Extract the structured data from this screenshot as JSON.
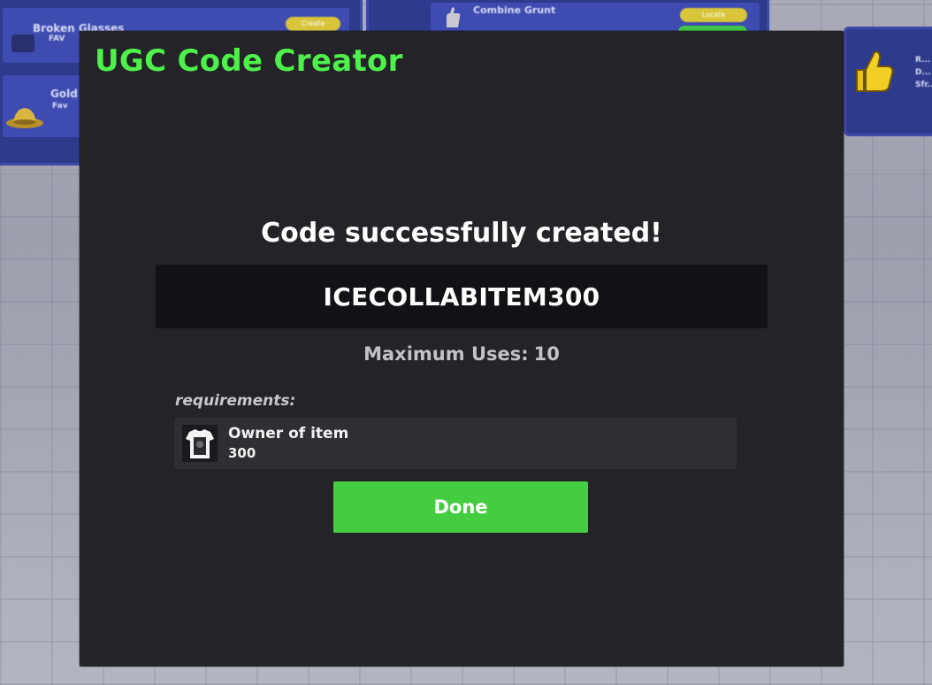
{
  "background": {
    "items": [
      {
        "name": "Broken Glasses",
        "sub": "FAV",
        "button": "Create"
      },
      {
        "name": "Gold",
        "sub": "Fav"
      },
      {
        "name": "Combine Grunt",
        "button": "Locate"
      }
    ],
    "right_note": "R... D... Sfr..."
  },
  "modal": {
    "title": "UGC Code Creator",
    "heading": "Code successfully created!",
    "code": "ICECOLLABITEM300",
    "max_uses_label": "Maximum Uses:",
    "max_uses_value": "10",
    "requirements_label": "requirements:",
    "requirement": {
      "title": "Owner of item",
      "value": "300",
      "icon": "shirt-icon"
    },
    "done_label": "Done"
  },
  "colors": {
    "title_green": "#4ef04a",
    "button_green": "#45cd41",
    "modal_bg": "#232328",
    "code_box_bg": "#121216"
  }
}
